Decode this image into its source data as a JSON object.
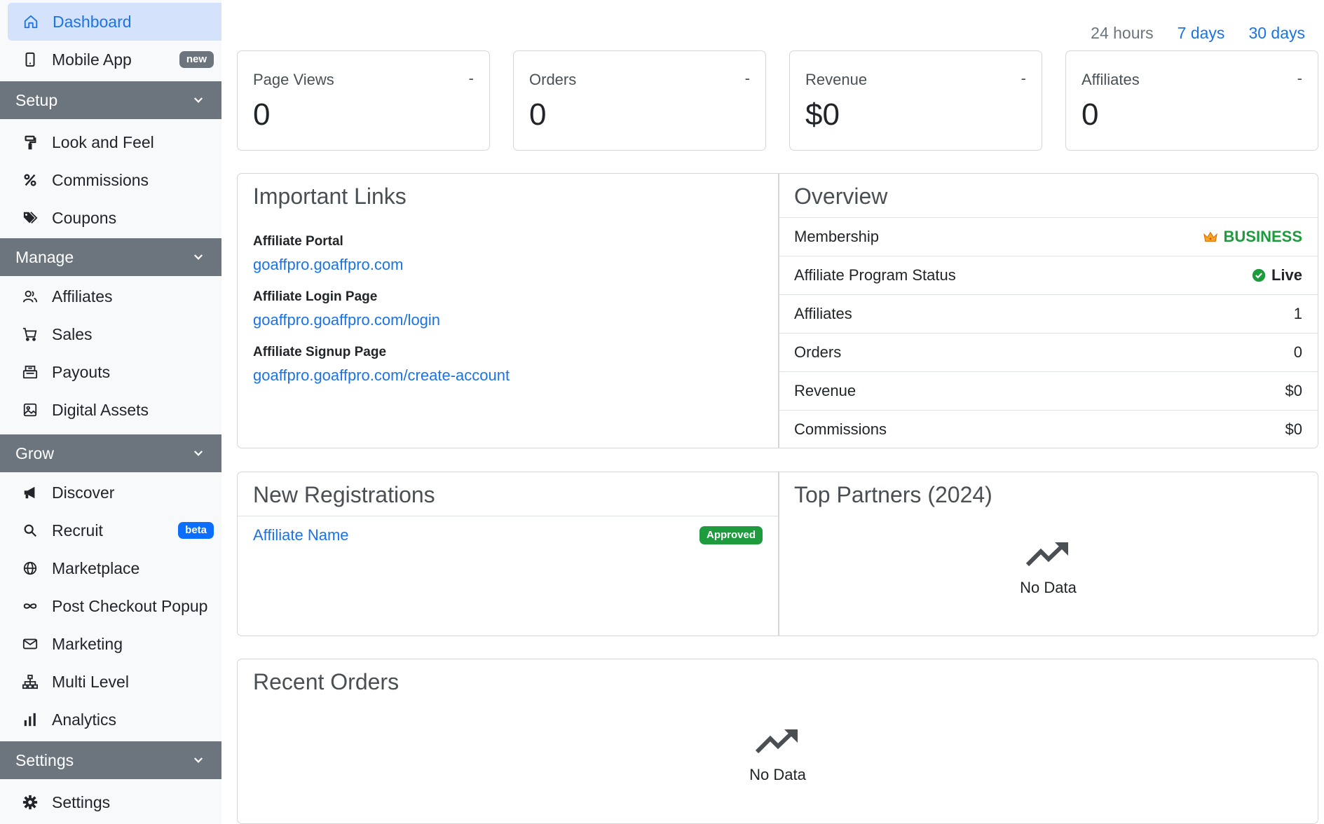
{
  "sidebar": {
    "dashboard": {
      "label": "Dashboard"
    },
    "mobile_app": {
      "label": "Mobile App",
      "badge": "new"
    },
    "setup": {
      "title": "Setup",
      "items": [
        "Look and Feel",
        "Commissions",
        "Coupons"
      ]
    },
    "manage": {
      "title": "Manage",
      "items": [
        "Affiliates",
        "Sales",
        "Payouts",
        "Digital Assets"
      ]
    },
    "grow": {
      "title": "Grow",
      "items": [
        "Discover",
        "Recruit",
        "Marketplace",
        "Post Checkout Popup",
        "Marketing",
        "Multi Level",
        "Analytics"
      ],
      "recruit_badge": "beta"
    },
    "settings": {
      "title": "Settings",
      "items": [
        "Settings"
      ]
    }
  },
  "range": {
    "h24": "24 hours",
    "d7": "7 days",
    "d30": "30 days"
  },
  "stats": [
    {
      "label": "Page Views",
      "dash": "-",
      "value": "0"
    },
    {
      "label": "Orders",
      "dash": "-",
      "value": "0"
    },
    {
      "label": "Revenue",
      "dash": "-",
      "value": "$0"
    },
    {
      "label": "Affiliates",
      "dash": "-",
      "value": "0"
    }
  ],
  "important_links": {
    "title": "Important Links",
    "links": [
      {
        "label": "Affiliate Portal",
        "url": "goaffpro.goaffpro.com"
      },
      {
        "label": "Affiliate Login Page",
        "url": "goaffpro.goaffpro.com/login"
      },
      {
        "label": "Affiliate Signup Page",
        "url": "goaffpro.goaffpro.com/create-account"
      }
    ]
  },
  "overview": {
    "title": "Overview",
    "rows": [
      {
        "label": "Membership",
        "value": "BUSINESS"
      },
      {
        "label": "Affiliate Program Status",
        "value": "Live"
      },
      {
        "label": "Affiliates",
        "value": "1"
      },
      {
        "label": "Orders",
        "value": "0"
      },
      {
        "label": "Revenue",
        "value": "$0"
      },
      {
        "label": "Commissions",
        "value": "$0"
      }
    ]
  },
  "new_registrations": {
    "title": "New Registrations",
    "rows": [
      {
        "name": "Affiliate Name",
        "status": "Approved"
      }
    ]
  },
  "top_partners": {
    "title": "Top Partners (2024)",
    "empty": "No Data"
  },
  "recent_orders": {
    "title": "Recent Orders",
    "empty": "No Data"
  },
  "colors": {
    "accent": "#1a73e8",
    "active_bg": "#d4e3fb",
    "section_bg": "#6c757d",
    "success": "#1e9b3d",
    "beta_badge": "#0d6efd"
  }
}
